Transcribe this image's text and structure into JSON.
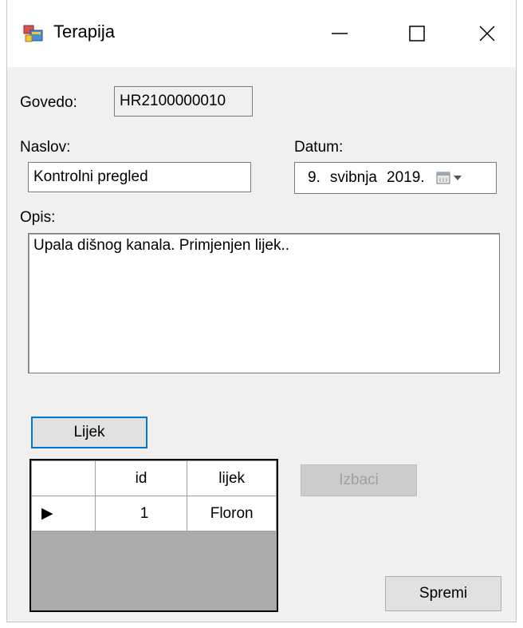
{
  "window": {
    "title": "Terapija",
    "minimize_glyph": "—",
    "close_glyph": "✕"
  },
  "form": {
    "govedo_label": "Govedo:",
    "govedo_value": "HR2100000010",
    "naslov_label": "Naslov:",
    "naslov_value": "Kontrolni pregled",
    "datum_label": "Datum:",
    "datum_day": "9.",
    "datum_month": "svibnja",
    "datum_year": "2019.",
    "opis_label": "Opis:",
    "opis_value": "Upala dišnog kanala. Primjenjen lijek.."
  },
  "buttons": {
    "lijek": "Lijek",
    "izbaci": "Izbaci",
    "spremi": "Spremi"
  },
  "grid": {
    "columns": [
      "",
      "id",
      "lijek"
    ],
    "rows": [
      {
        "indicator": "▶",
        "id": "1",
        "lijek": "Floron"
      }
    ]
  },
  "colors": {
    "accent": "#0078d7",
    "window_bg": "#f0f0f0",
    "grid_empty": "#ababab"
  }
}
